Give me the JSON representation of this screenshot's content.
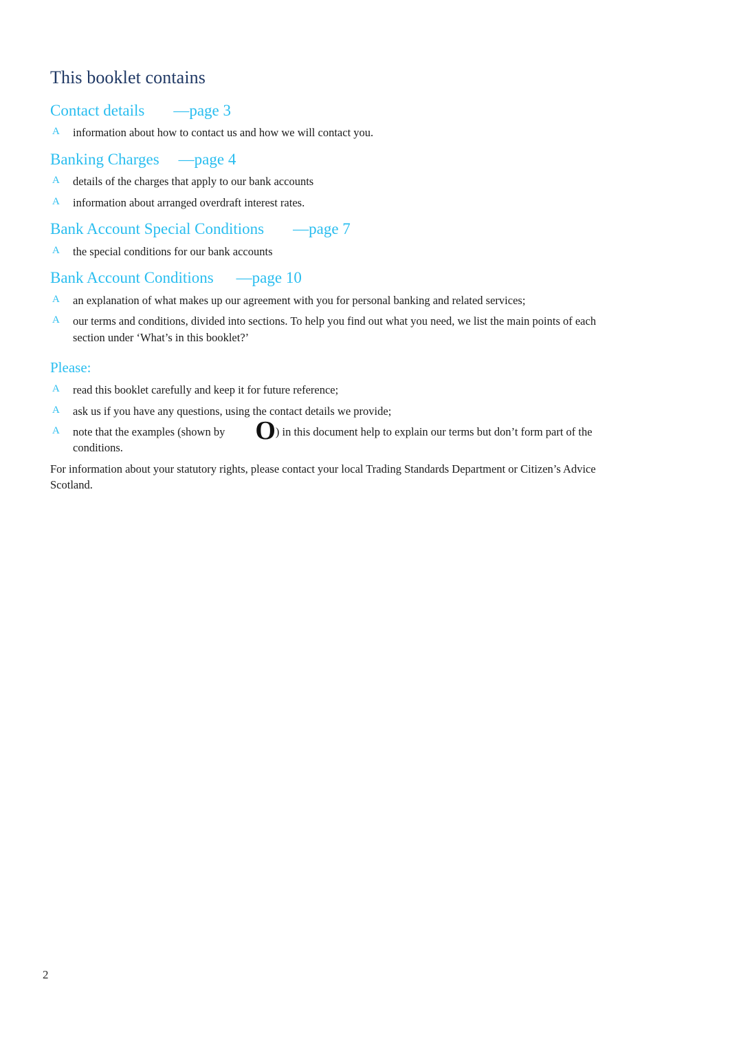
{
  "document": {
    "title": "This booklet contains",
    "page_number": "2",
    "colors": {
      "title_navy": "#1f3864",
      "heading_cyan": "#29bdef",
      "body_text": "#1a1a1a",
      "background": "#ffffff"
    }
  },
  "sections": [
    {
      "heading": "Contact details",
      "page_ref": "—page 3",
      "bullets": [
        "information about how to contact us and how we will contact you."
      ]
    },
    {
      "heading": "Banking Charges",
      "page_ref": "—page 4",
      "bullets": [
        "details of the charges that apply to our bank accounts",
        "information about arranged overdraft interest rates."
      ]
    },
    {
      "heading": "Bank Account Special Conditions",
      "page_ref": "—page 7",
      "bullets": [
        "the special conditions for our bank accounts"
      ]
    },
    {
      "heading": "Bank Account Conditions",
      "page_ref": "—page 10",
      "bullets": [
        "an explanation of what makes up our agreement with you for personal banking and related services;",
        "our terms and conditions, divided into sections. To help you find out what you need, we list the main points of each section under ‘What’s in this booklet?’"
      ]
    }
  ],
  "please": {
    "heading": "Please:",
    "bullets": [
      "read this booklet carefully and keep it for future reference;",
      "ask us if you have any questions, using the contact details we provide;"
    ],
    "example_bullet": {
      "text_before": "note that the examples (shown by",
      "glyph": "O",
      "text_after": ") in this document help to explain our terms but don’t form part of the conditions."
    }
  },
  "closing_paragraph": "For information about your statutory rights, please contact your local Trading Standards Department or Citizen’s Advice Scotland.",
  "bullet_marker": "A"
}
